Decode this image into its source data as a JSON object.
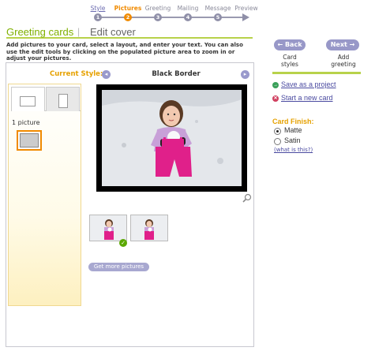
{
  "steps": [
    {
      "label": "Style",
      "num": "1",
      "state": "link"
    },
    {
      "label": "Pictures",
      "num": "2",
      "state": "active"
    },
    {
      "label": "Greeting",
      "num": "3",
      "state": "normal"
    },
    {
      "label": "Mailing",
      "num": "4",
      "state": "normal"
    },
    {
      "label": "Message",
      "num": "5",
      "state": "normal"
    },
    {
      "label": "Preview",
      "num": "",
      "state": "normal"
    }
  ],
  "header": {
    "title": "Greeting cards",
    "separator": "|",
    "subtitle": "Edit cover"
  },
  "instructions": "Add pictures to your card, select a layout, and enter your text. You can also use the edit tools by clicking on the populated picture area to zoom in or adjust your pictures.",
  "editor": {
    "current_style_label": "Current Style:",
    "style_name": "Black Border",
    "prev_glyph": "◂",
    "next_glyph": "▸",
    "layout_label": "1 picture",
    "get_more_label": "Get more pictures",
    "check_glyph": "✓"
  },
  "nav": {
    "back_label": "← Back",
    "next_label": "Next →",
    "back_caption": "Card styles",
    "next_caption": "Add greeting"
  },
  "links": {
    "save_label": "Save as a project",
    "new_label": "Start a new card",
    "save_icon_glyph": "→",
    "new_icon_glyph": "✕"
  },
  "finish": {
    "title": "Card Finish:",
    "options": [
      {
        "label": "Matte",
        "selected": true
      },
      {
        "label": "Satin",
        "selected": false
      }
    ],
    "help_label": "(what is this?)"
  },
  "colors": {
    "accent_orange": "#f08a00",
    "accent_green": "#7fb000",
    "button_purple": "#9898c8"
  }
}
